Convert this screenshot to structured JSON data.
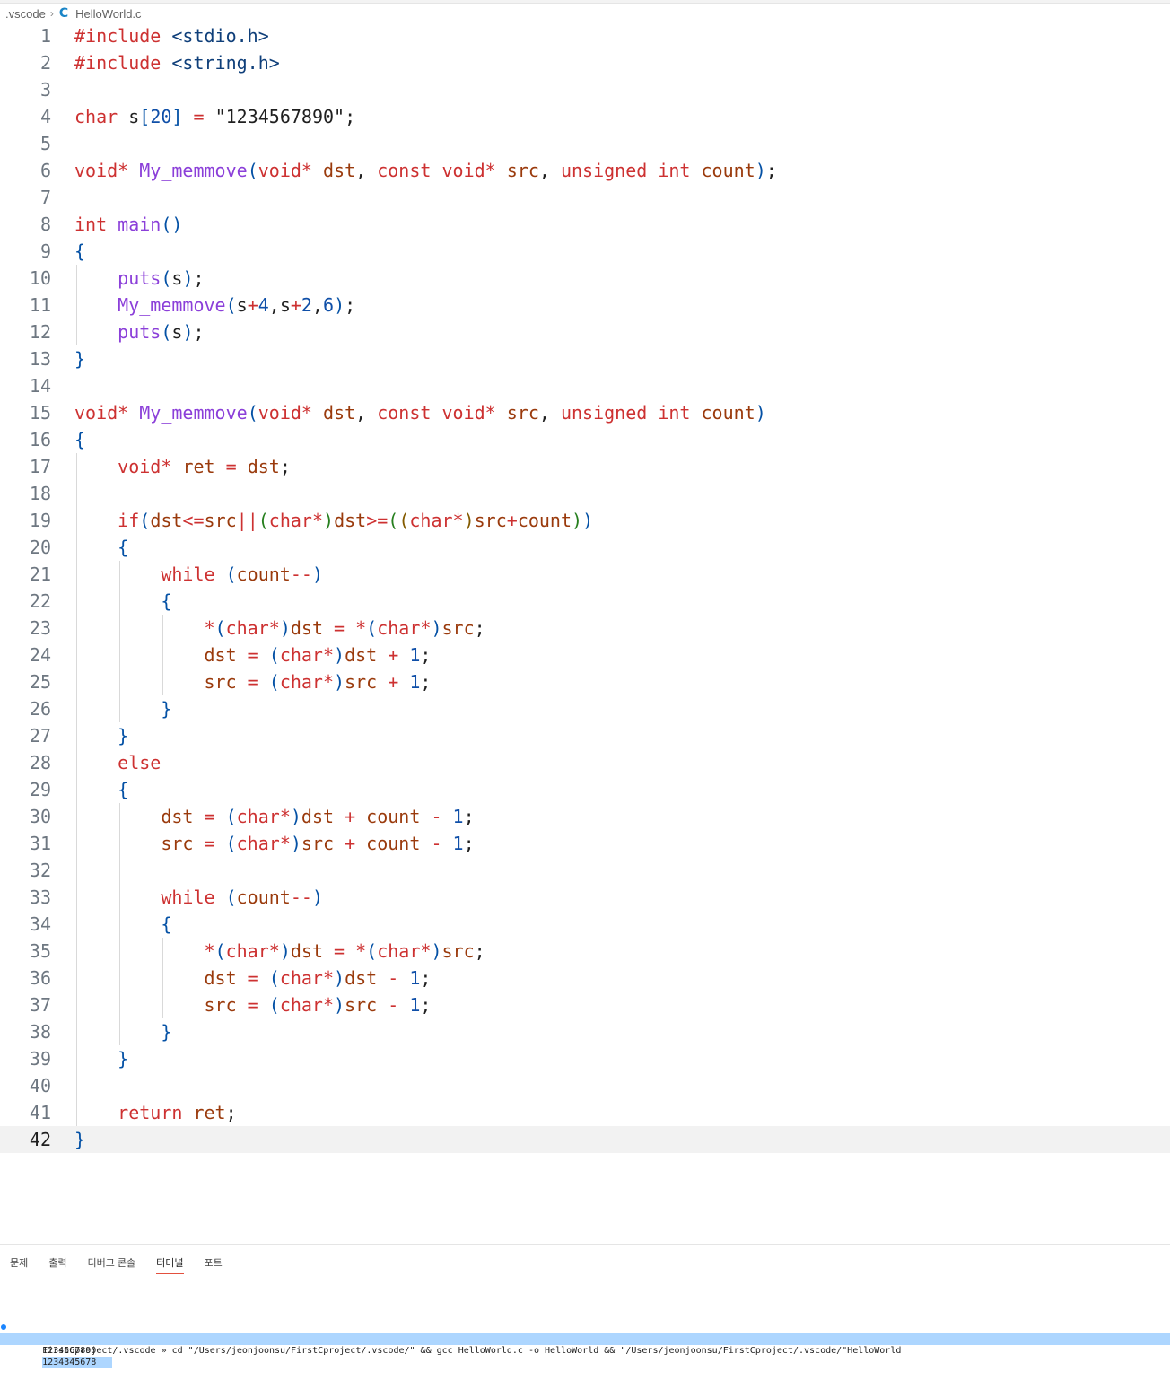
{
  "breadcrumb": {
    "folder": ".vscode",
    "file": "HelloWorld.c",
    "file_icon": "C"
  },
  "editor": {
    "current_line": 42,
    "colors": {
      "keyword": "#cd3131",
      "type": "#c72e0f",
      "func": "#8b3fd9",
      "num": "#0f4fa8",
      "str": "#a31515",
      "var": "#9a3a0c",
      "brace1": "#0451a5",
      "brace2": "#267f1e",
      "brace3": "#845b00"
    },
    "lines": [
      "#include <stdio.h>",
      "#include <string.h>",
      "",
      "char s[20] = \"1234567890\";",
      "",
      "void* My_memmove(void* dst, const void* src, unsigned int count);",
      "",
      "int main()",
      "{",
      "    puts(s);",
      "    My_memmove(s+4,s+2,6);",
      "    puts(s);",
      "}",
      "",
      "void* My_memmove(void* dst, const void* src, unsigned int count)",
      "{",
      "    void* ret = dst;",
      "",
      "    if(dst<=src||(char*)dst>=((char*)src+count))",
      "    {",
      "        while (count--)",
      "        {",
      "            *(char*)dst = *(char*)src;",
      "            dst = (char*)dst + 1;",
      "            src = (char*)src + 1;",
      "        }",
      "    }",
      "    else",
      "    {",
      "        dst = (char*)dst + count - 1;",
      "        src = (char*)src + count - 1;",
      "",
      "        while (count--)",
      "        {",
      "            *(char*)dst = *(char*)src;",
      "            dst = (char*)dst - 1;",
      "            src = (char*)src - 1;",
      "        }",
      "    }",
      "",
      "    return ret;",
      "}"
    ]
  },
  "panel": {
    "tabs": [
      {
        "label": "문제",
        "active": false
      },
      {
        "label": "출력",
        "active": false
      },
      {
        "label": "디버그 콘솔",
        "active": false
      },
      {
        "label": "터미널",
        "active": true
      },
      {
        "label": "포트",
        "active": false
      }
    ],
    "terminal": {
      "command": "FirstCproject/.vscode » cd \"/Users/jeonjoonsu/FirstCproject/.vscode/\" && gcc HelloWorld.c -o HelloWorld && \"/Users/jeonjoonsu/FirstCproject/.vscode/\"HelloWorld",
      "output": [
        "1234567890",
        "1234345678"
      ]
    }
  }
}
